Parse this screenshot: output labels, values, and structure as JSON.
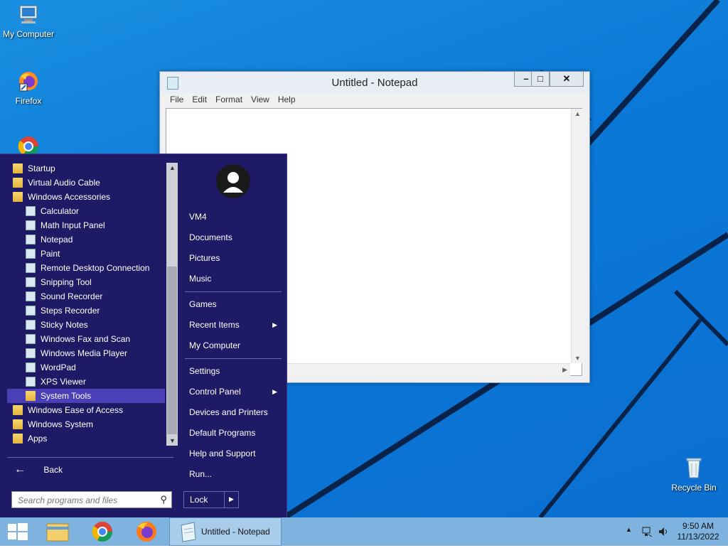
{
  "desktop": {
    "icons": [
      {
        "label": "My Computer"
      },
      {
        "label": "Firefox"
      },
      {
        "label": "Recycle Bin"
      }
    ]
  },
  "notepad": {
    "title": "Untitled - Notepad",
    "menu": [
      "File",
      "Edit",
      "Format",
      "View",
      "Help"
    ],
    "content": "",
    "buttons": {
      "minimize": "–",
      "maximize": "□",
      "close": "✕"
    }
  },
  "start_menu": {
    "programs": [
      {
        "label": "Startup",
        "icon": "folder-icon"
      },
      {
        "label": "Virtual Audio Cable",
        "icon": "folder-icon"
      },
      {
        "label": "Windows Accessories",
        "icon": "folder-icon"
      },
      {
        "label": "Calculator",
        "icon": "calculator-icon"
      },
      {
        "label": "Math Input Panel",
        "icon": "math-input-icon"
      },
      {
        "label": "Notepad",
        "icon": "notepad-icon"
      },
      {
        "label": "Paint",
        "icon": "paint-icon"
      },
      {
        "label": "Remote Desktop Connection",
        "icon": "remote-desktop-icon"
      },
      {
        "label": "Snipping Tool",
        "icon": "snipping-tool-icon"
      },
      {
        "label": "Sound Recorder",
        "icon": "microphone-icon"
      },
      {
        "label": "Steps Recorder",
        "icon": "steps-recorder-icon"
      },
      {
        "label": "Sticky Notes",
        "icon": "sticky-notes-icon"
      },
      {
        "label": "Windows Fax and Scan",
        "icon": "fax-icon"
      },
      {
        "label": "Windows Media Player",
        "icon": "media-player-icon"
      },
      {
        "label": "WordPad",
        "icon": "wordpad-icon"
      },
      {
        "label": "XPS Viewer",
        "icon": "xps-viewer-icon"
      },
      {
        "label": "System Tools",
        "icon": "folder-icon",
        "selected": true
      },
      {
        "label": "Windows Ease of Access",
        "icon": "folder-icon"
      },
      {
        "label": "Windows System",
        "icon": "folder-icon"
      },
      {
        "label": "Apps",
        "icon": "folder-icon"
      }
    ],
    "back_label": "Back",
    "search_placeholder": "Search programs and files",
    "right": {
      "user": "VM4",
      "items_group1": [
        "Documents",
        "Pictures",
        "Music"
      ],
      "items_group2": [
        "Games",
        "Recent Items",
        "My Computer"
      ],
      "items_group3": [
        "Settings",
        "Control Panel",
        "Devices and Printers",
        "Default Programs",
        "Help and Support",
        "Run..."
      ],
      "lock_label": "Lock"
    }
  },
  "taskbar": {
    "active_window": "Untitled - Notepad",
    "time": "9:50 AM",
    "date": "11/13/2022"
  },
  "colors": {
    "desktop": "#0a78d7",
    "start_menu": "#1f1a66",
    "selected": "#4b3fb8",
    "taskbar": "#7db3de"
  }
}
